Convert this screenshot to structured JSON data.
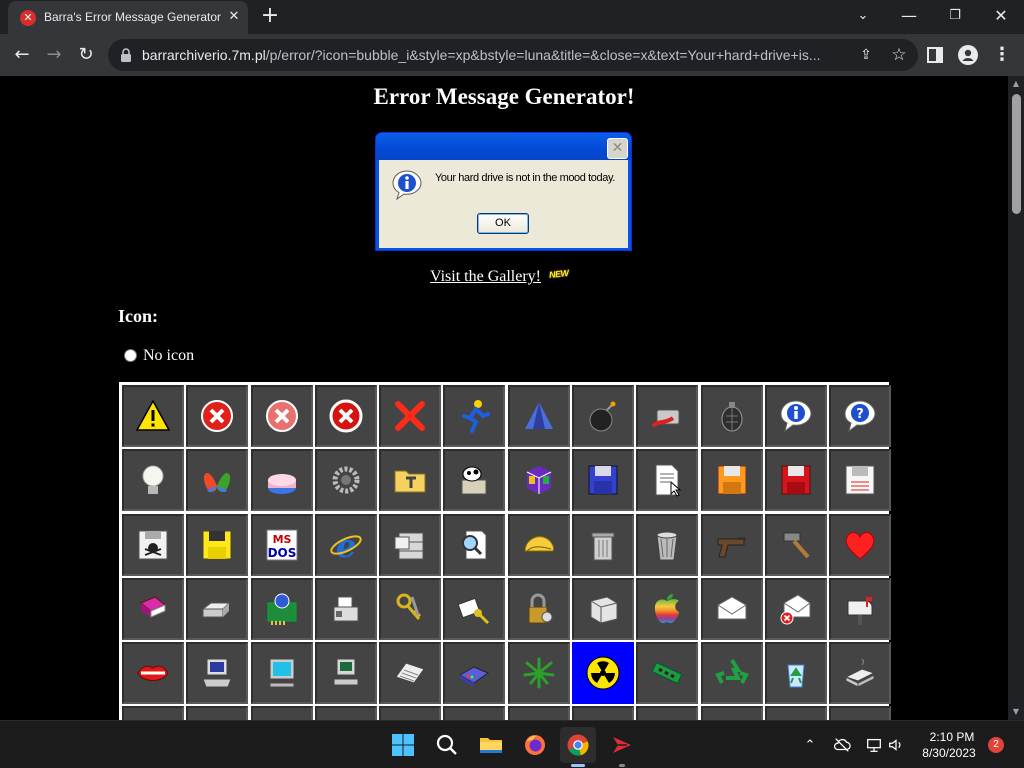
{
  "browser": {
    "tab_title": "Barra's Error Message Generator",
    "url_host": "barrarchiverio.7m.pl",
    "url_path": "/p/error/?icon=bubble_i&style=xp&bstyle=luna&title=&close=x&text=Your+hard+drive+is..."
  },
  "page": {
    "title": "Error Message Generator!",
    "gallery_link": "Visit the Gallery!",
    "new_badge": "NEW",
    "icon_heading": "Icon:",
    "no_icon_label": "No icon"
  },
  "dialog": {
    "message": "Your hard drive is not in the mood today.",
    "ok_label": "OK",
    "close_glyph": "✕"
  },
  "icon_grid": {
    "selected_index": 55,
    "icons": [
      "warning-icon",
      "error-x-icon",
      "error-x-faded-icon",
      "error-x-bordered-icon",
      "red-x-icon",
      "aim-runner-icon",
      "tent-icon",
      "bomb-icon",
      "briefcase-hand-icon",
      "grenade-icon",
      "info-bubble-icon",
      "question-bubble-icon",
      "lightbulb-icon",
      "msn-butterfly-icon",
      "cake-icon",
      "gears-icon",
      "folder-tools-icon",
      "cow-box-icon",
      "cube-icon",
      "floppy-blue-icon",
      "document-cursor-icon",
      "floppy-orange-icon",
      "floppy-red-icon",
      "floppy-white-icon",
      "floppy-skull-icon",
      "floppy-yellow-icon",
      "msdos-icon",
      "ie-logo-icon",
      "file-cabinet-icon",
      "magnifier-doc-icon",
      "taco-icon",
      "trash-can-icon",
      "trash-metal-icon",
      "gun-icon",
      "hammer-icon",
      "heart-icon",
      "book-icon",
      "printer-icon",
      "network-card-icon",
      "fax-icon",
      "keys-icon",
      "key-card-icon",
      "padlock-icon",
      "scanner-icon",
      "apple-logo-icon",
      "envelope-icon",
      "envelope-error-icon",
      "mailbox-icon",
      "lips-icon",
      "computer-old-icon",
      "computer-crt-icon",
      "computer-small-icon",
      "keyboard-icon",
      "modem-icon",
      "leaf-icon",
      "radiation-icon",
      "ram-chip-icon",
      "recycle-icon",
      "recycle-bin-icon",
      "hard-drive-icon"
    ]
  },
  "taskbar": {
    "time": "2:10 PM",
    "date": "8/30/2023",
    "notification_count": "2"
  }
}
